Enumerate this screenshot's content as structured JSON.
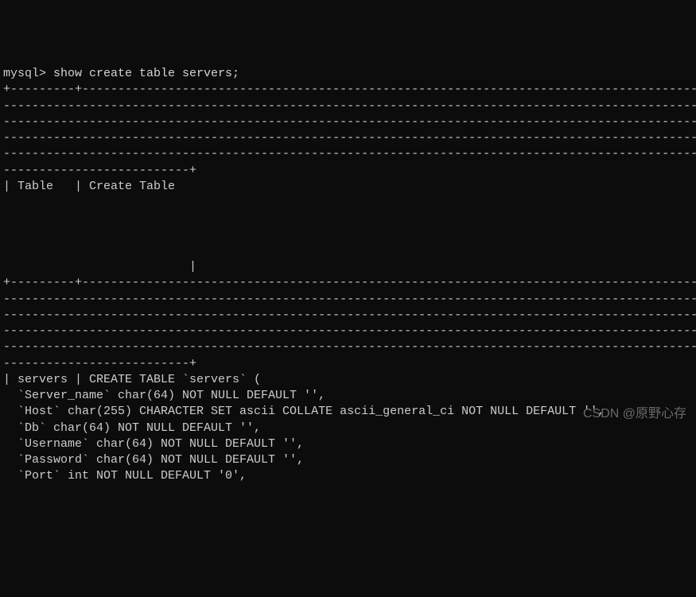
{
  "terminal": {
    "prompt": "mysql>",
    "command": " show create table servers;",
    "lines": [
      "+---------+--------------------------------------------------------------------------------------------",
      "---------------------------------------------------------------------------------------------------------",
      "---------------------------------------------------------------------------------------------------------",
      "---------------------------------------------------------------------------------------------------------",
      "---------------------------------------------------------------------------------------------------------",
      "--------------------------+",
      "| Table   | Create Table                                                                               ",
      "                                                                                                         ",
      "                                                                                                         ",
      "                                                                                                         ",
      "                                                                                                         ",
      "                          |",
      "+---------+--------------------------------------------------------------------------------------------",
      "---------------------------------------------------------------------------------------------------------",
      "---------------------------------------------------------------------------------------------------------",
      "---------------------------------------------------------------------------------------------------------",
      "---------------------------------------------------------------------------------------------------------",
      "--------------------------+",
      "| servers | CREATE TABLE `servers` (",
      "  `Server_name` char(64) NOT NULL DEFAULT '',",
      "  `Host` char(255) CHARACTER SET ascii COLLATE ascii_general_ci NOT NULL DEFAULT '',",
      "  `Db` char(64) NOT NULL DEFAULT '',",
      "  `Username` char(64) NOT NULL DEFAULT '',",
      "  `Password` char(64) NOT NULL DEFAULT '',",
      "  `Port` int NOT NULL DEFAULT '0',"
    ]
  },
  "watermark": "CSDN @原野心存"
}
